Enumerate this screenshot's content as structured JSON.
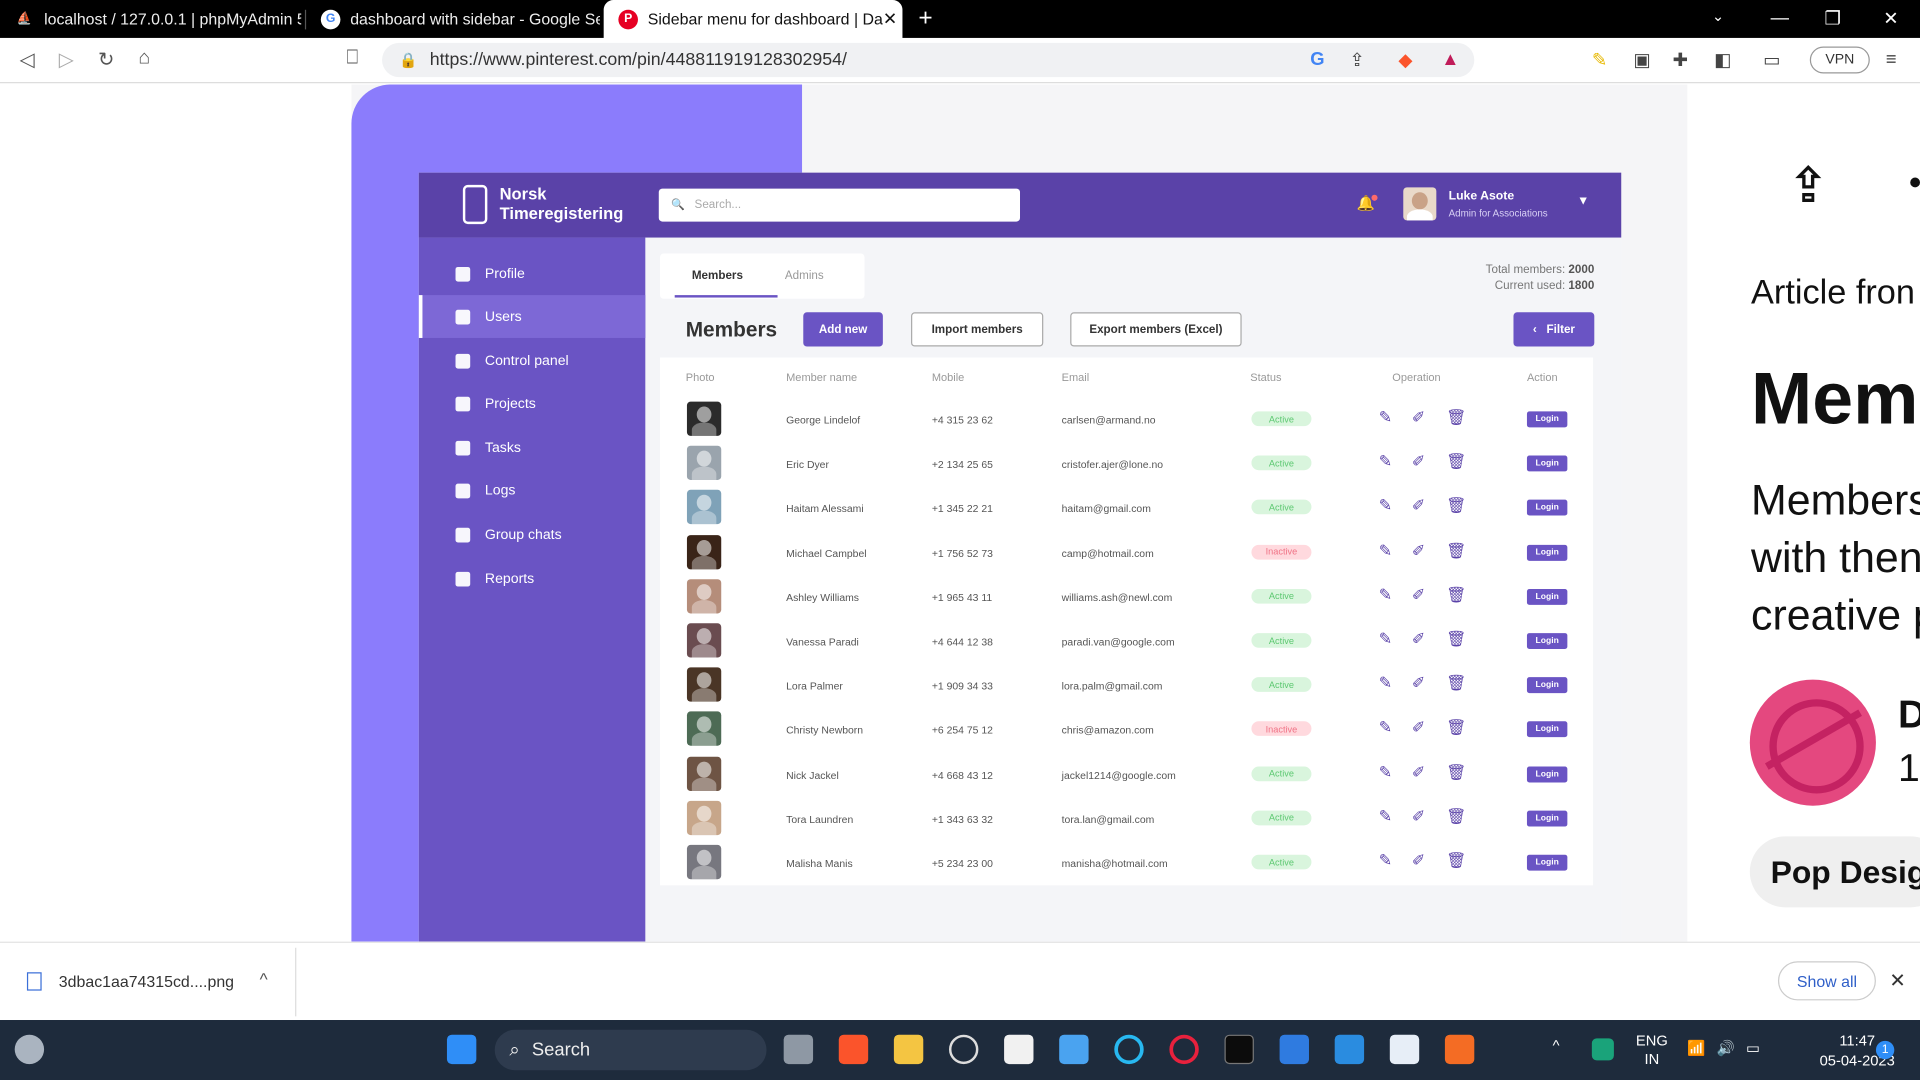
{
  "browser": {
    "tabs": [
      {
        "label": "localhost / 127.0.0.1 | phpMyAdmin 5.",
        "icon": "phpmyadmin-icon"
      },
      {
        "label": "dashboard with sidebar - Google Sear",
        "icon": "google-icon"
      },
      {
        "label": "Sidebar menu for dashboard | Da",
        "icon": "pinterest-icon"
      }
    ],
    "url": "https://www.pinterest.com/pin/448811919128302954/",
    "vpn": "VPN"
  },
  "dashboard": {
    "brand": {
      "line1": "Norsk",
      "line2": "Timeregistering"
    },
    "search_placeholder": "Search...",
    "user": {
      "name": "Luke Asote",
      "role": "Admin for Associations"
    },
    "sidebar": [
      {
        "label": "Profile"
      },
      {
        "label": "Users"
      },
      {
        "label": "Control panel"
      },
      {
        "label": "Projects"
      },
      {
        "label": "Tasks"
      },
      {
        "label": "Logs"
      },
      {
        "label": "Group chats"
      },
      {
        "label": "Reports"
      }
    ],
    "tabs": {
      "members": "Members",
      "admins": "Admins"
    },
    "totals": {
      "total_label": "Total members:",
      "total_value": "2000",
      "used_label": "Current used:",
      "used_value": "1800"
    },
    "heading": "Members",
    "buttons": {
      "add": "Add new",
      "import": "Import members",
      "export": "Export members (Excel)",
      "filter": "Filter"
    },
    "columns": [
      "Photo",
      "Member name",
      "Mobile",
      "Email",
      "Status",
      "Operation",
      "Action"
    ],
    "rows": [
      {
        "name": "George Lindelof",
        "mobile": "+4 315 23 62",
        "email": "carlsen@armand.no",
        "status": "Active",
        "login": "Login",
        "photo_color": "#2b2b2b"
      },
      {
        "name": "Eric Dyer",
        "mobile": "+2 134 25 65",
        "email": "cristofer.ajer@lone.no",
        "status": "Active",
        "login": "Login",
        "photo_color": "#9aa4ad"
      },
      {
        "name": "Haitam Alessami",
        "mobile": "+1 345 22 21",
        "email": "haitam@gmail.com",
        "status": "Active",
        "login": "Login",
        "photo_color": "#7fa2b8"
      },
      {
        "name": "Michael Campbel",
        "mobile": "+1 756 52 73",
        "email": "camp@hotmail.com",
        "status": "Inactive",
        "login": "Login",
        "photo_color": "#3a2418"
      },
      {
        "name": "Ashley Williams",
        "mobile": "+1 965 43 11",
        "email": "williams.ash@newl.com",
        "status": "Active",
        "login": "Login",
        "photo_color": "#b58d7a"
      },
      {
        "name": "Vanessa Paradi",
        "mobile": "+4 644 12 38",
        "email": "paradi.van@google.com",
        "status": "Active",
        "login": "Login",
        "photo_color": "#6a4c50"
      },
      {
        "name": "Lora Palmer",
        "mobile": "+1 909 34 33",
        "email": "lora.palm@gmail.com",
        "status": "Active",
        "login": "Login",
        "photo_color": "#4a3526"
      },
      {
        "name": "Christy Newborn",
        "mobile": "+6 254 75 12",
        "email": "chris@amazon.com",
        "status": "Inactive",
        "login": "Login",
        "photo_color": "#4d6b55"
      },
      {
        "name": "Nick Jackel",
        "mobile": "+4 668 43 12",
        "email": "jackel1214@google.com",
        "status": "Active",
        "login": "Login",
        "photo_color": "#6e5444"
      },
      {
        "name": "Tora Laundren",
        "mobile": "+1 343 63 32",
        "email": "tora.lan@gmail.com",
        "status": "Active",
        "login": "Login",
        "photo_color": "#c7a68a"
      },
      {
        "name": "Malisha Manis",
        "mobile": "+5 234 23 00",
        "email": "manisha@hotmail.com",
        "status": "Active",
        "login": "Login",
        "photo_color": "#77777f"
      }
    ]
  },
  "article": {
    "from": "Article fron",
    "title": "Mem",
    "desc": [
      "Members",
      "with then",
      "creative p"
    ],
    "author_initial": "D",
    "author_count": "1",
    "pop_button": "Pop Design"
  },
  "download": {
    "file": "3dbac1aa74315cd....png",
    "show_all": "Show all"
  },
  "taskbar": {
    "search": "Search",
    "lang1": "ENG",
    "lang2": "IN",
    "time": "11:47",
    "date": "05-04-2023",
    "notif": "1"
  },
  "colors": {
    "accent": "#5a42a8",
    "sidebar": "#6a54c4",
    "bg_purple": "#8b7cfc",
    "active": "#5cc870",
    "inactive": "#f07285"
  }
}
